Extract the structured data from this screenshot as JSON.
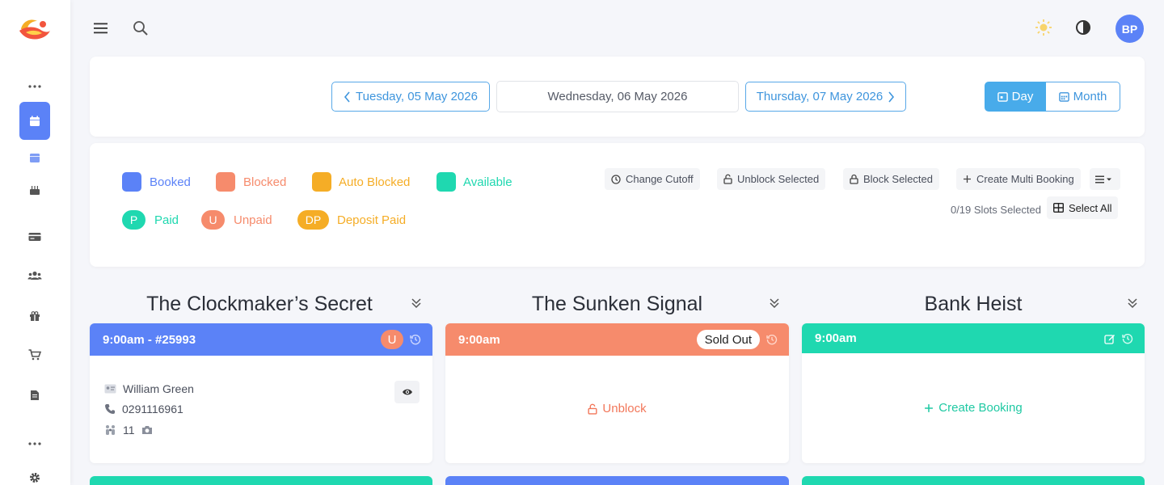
{
  "user": {
    "initials": "BP"
  },
  "date_nav": {
    "prev_label": "Tuesday, 05 May 2026",
    "current_label": "Wednesday, 06 May 2026",
    "next_label": "Thursday, 07 May 2026"
  },
  "view_toggle": {
    "day_label": "Day",
    "month_label": "Month",
    "selected": "Day"
  },
  "legend": {
    "booked": "Booked",
    "blocked": "Blocked",
    "auto_blocked": "Auto Blocked",
    "available": "Available",
    "paid_abbr": "P",
    "paid": "Paid",
    "unpaid_abbr": "U",
    "unpaid": "Unpaid",
    "deposit_abbr": "DP",
    "deposit_paid": "Deposit Paid"
  },
  "colors": {
    "booked": "#5b82f7",
    "blocked": "#f68b6c",
    "auto_blocked": "#f5ad26",
    "available": "#1fd8b0",
    "accent": "#48abea"
  },
  "toolbar": {
    "change_cutoff": "Change Cutoff",
    "unblock_selected": "Unblock Selected",
    "block_selected": "Block Selected",
    "create_multi_booking": "Create Multi Booking",
    "slots_selected": "0/19 Slots Selected",
    "select_all": "Select All"
  },
  "rooms": [
    {
      "title": "The Clockmaker’s Secret",
      "slot": {
        "header": "9:00am - #25993",
        "status": "booked",
        "payment_badge": "U",
        "customer": "William Green",
        "phone": "0291116961",
        "players": "11"
      }
    },
    {
      "title": "The Sunken Signal",
      "slot": {
        "header": "9:00am",
        "status": "blocked",
        "badge": "Sold Out",
        "action": "Unblock"
      }
    },
    {
      "title": "Bank Heist",
      "slot": {
        "header": "9:00am",
        "status": "available",
        "action": "Create Booking"
      }
    }
  ]
}
